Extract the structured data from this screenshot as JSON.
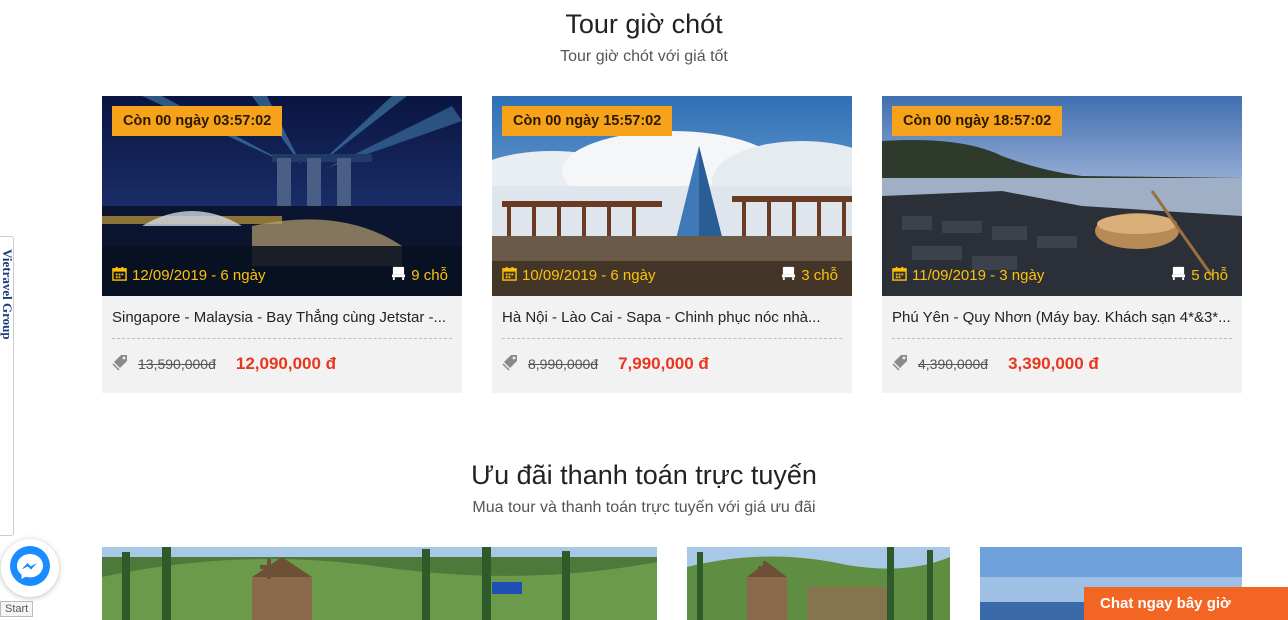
{
  "section1": {
    "title": "Tour giờ chót",
    "subtitle": "Tour giờ chót với giá tốt"
  },
  "tours": [
    {
      "countdown": "Còn 00 ngày 03:57:02",
      "date": "12/09/2019 - 6 ngày",
      "seats": "9 chỗ",
      "name": "Singapore - Malaysia - Bay Thẳng cùng Jetstar -...",
      "old_price": "13,590,000đ",
      "new_price": "12,090,000 đ"
    },
    {
      "countdown": "Còn 00 ngày 15:57:02",
      "date": "10/09/2019 - 6 ngày",
      "seats": "3 chỗ",
      "name": "Hà Nội - Lào Cai - Sapa - Chinh phục nóc nhà...",
      "old_price": "8,990,000đ",
      "new_price": "7,990,000 đ"
    },
    {
      "countdown": "Còn 00 ngày 18:57:02",
      "date": "11/09/2019 - 3 ngày",
      "seats": "5 chỗ",
      "name": "Phú Yên - Quy Nhơn (Máy bay. Khách sạn 4*&3*...",
      "old_price": "4,390,000đ",
      "new_price": "3,390,000 đ"
    }
  ],
  "section2": {
    "title": "Ưu đãi thanh toán trực tuyến",
    "subtitle": "Mua tour và thanh toán trực tuyến với giá ưu đãi"
  },
  "sidebar_tab": {
    "label": "Vietravel Group"
  },
  "start_label": "Start",
  "chat_button": {
    "label": "Chat ngay bây giờ"
  },
  "colors": {
    "countdown_bg": "#f6a21b",
    "meta_text": "#ffc107",
    "new_price": "#e9361f",
    "chat_bg": "#f26522"
  },
  "icons": {
    "date": "calendar-icon",
    "seats": "seat-icon",
    "price": "price-tag-icon",
    "messenger": "messenger-icon"
  }
}
